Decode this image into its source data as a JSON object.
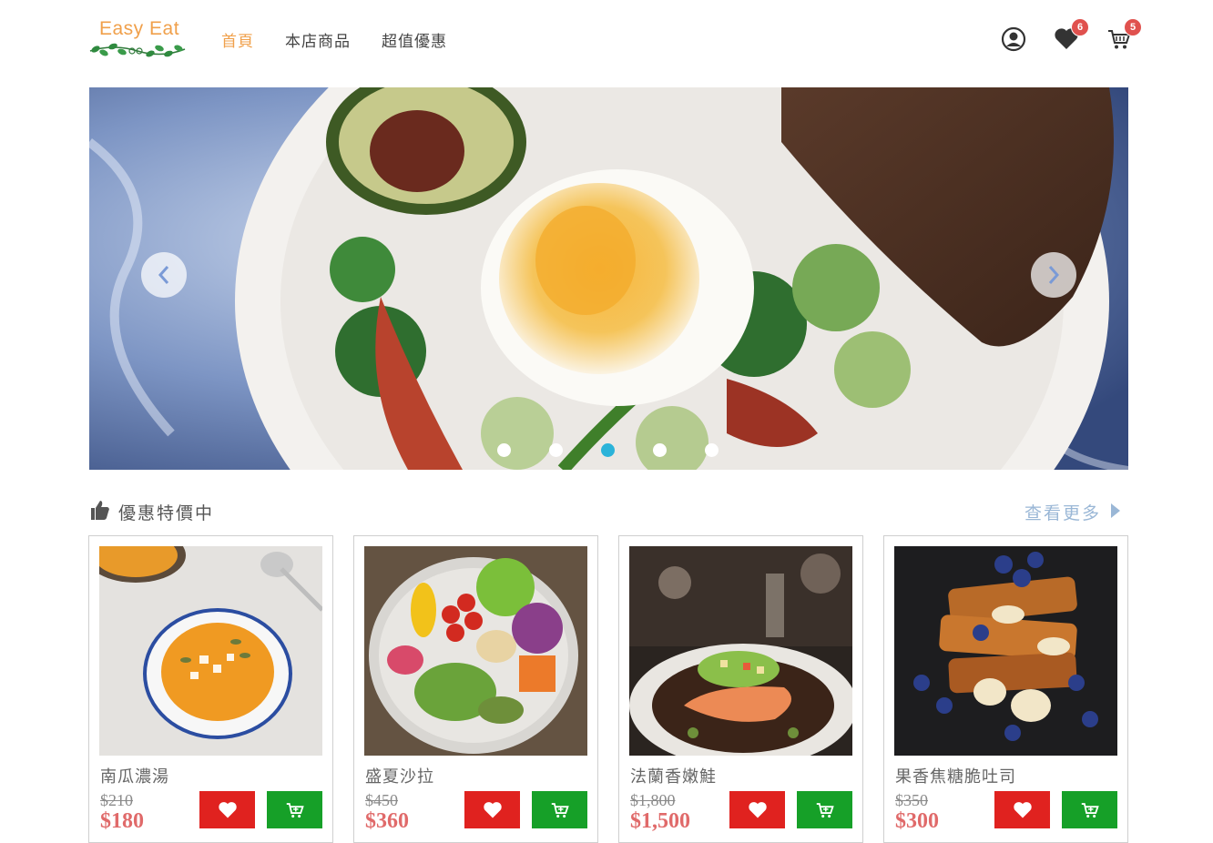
{
  "header": {
    "logo_text": "Easy Eat",
    "nav": [
      {
        "label": "首頁",
        "active": true
      },
      {
        "label": "本店商品",
        "active": false
      },
      {
        "label": "超值優惠",
        "active": false
      }
    ],
    "wishlist_count": "6",
    "cart_count": "5"
  },
  "carousel": {
    "slide_count": 5,
    "active_index": 2
  },
  "section": {
    "title": "優惠特價中",
    "more_label": "查看更多"
  },
  "products": [
    {
      "name": "南瓜濃湯",
      "old_price": "$210",
      "price": "$180"
    },
    {
      "name": "盛夏沙拉",
      "old_price": "$450",
      "price": "$360"
    },
    {
      "name": "法蘭香嫩鮭",
      "old_price": "$1,800",
      "price": "$1,500"
    },
    {
      "name": "果香焦糖脆吐司",
      "old_price": "$350",
      "price": "$300"
    }
  ],
  "colors": {
    "accent_orange": "#f0a04b",
    "badge_red": "#e0514e",
    "like_red": "#e0221f",
    "cart_green": "#16a028",
    "price_red": "#e06a6a",
    "dot_active": "#2bb3d9",
    "more_link": "#9ab7d6"
  },
  "icons": {
    "user": "user-circle-icon",
    "wishlist": "heart-icon",
    "cart": "cart-icon",
    "section": "thumbs-up-icon",
    "more": "caret-right-icon"
  }
}
